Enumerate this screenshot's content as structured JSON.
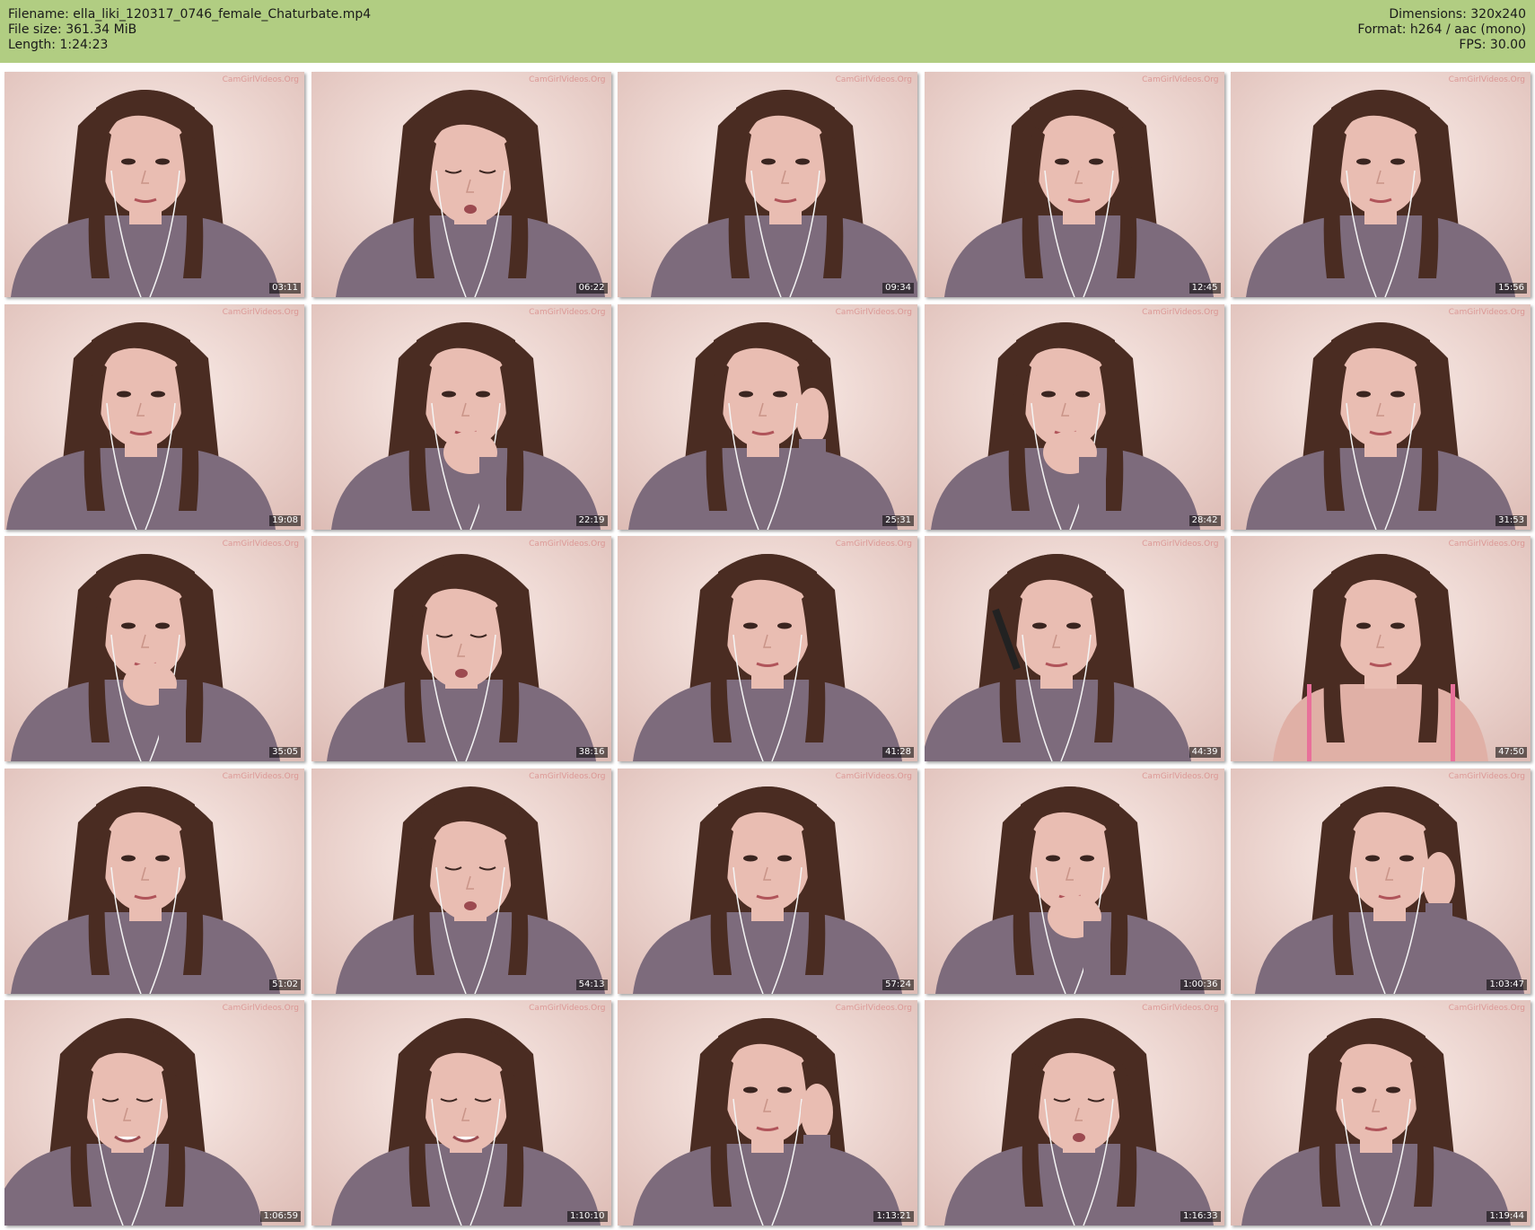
{
  "header": {
    "filename": "Filename: ella_liki_120317_0746_female_Chaturbate.mp4",
    "filesize": "File size: 361.34 MiB",
    "length": "Length: 1:24:23",
    "dimensions": "Dimensions: 320x240",
    "format": "Format: h264 / aac (mono)",
    "fps": "FPS: 30.00"
  },
  "colors": {
    "header_bg": "#b1cd82",
    "wall": "#f2e0dd",
    "hair": "#4a2c22",
    "skin": "#e9bdb2",
    "shirt": "#7d6b7c"
  },
  "watermark": "CamGirlVideos.Org",
  "thumbnails": [
    {
      "timestamp": "03:11"
    },
    {
      "timestamp": "06:22"
    },
    {
      "timestamp": "09:34"
    },
    {
      "timestamp": "12:45"
    },
    {
      "timestamp": "15:56"
    },
    {
      "timestamp": "19:08"
    },
    {
      "timestamp": "22:19"
    },
    {
      "timestamp": "25:31"
    },
    {
      "timestamp": "28:42"
    },
    {
      "timestamp": "31:53"
    },
    {
      "timestamp": "35:05"
    },
    {
      "timestamp": "38:16"
    },
    {
      "timestamp": "41:28"
    },
    {
      "timestamp": "44:39"
    },
    {
      "timestamp": "47:50"
    },
    {
      "timestamp": "51:02"
    },
    {
      "timestamp": "54:13"
    },
    {
      "timestamp": "57:24"
    },
    {
      "timestamp": "1:00:36"
    },
    {
      "timestamp": "1:03:47"
    },
    {
      "timestamp": "1:06:59"
    },
    {
      "timestamp": "1:10:10"
    },
    {
      "timestamp": "1:13:21"
    },
    {
      "timestamp": "1:16:33"
    },
    {
      "timestamp": "1:19:44"
    }
  ]
}
